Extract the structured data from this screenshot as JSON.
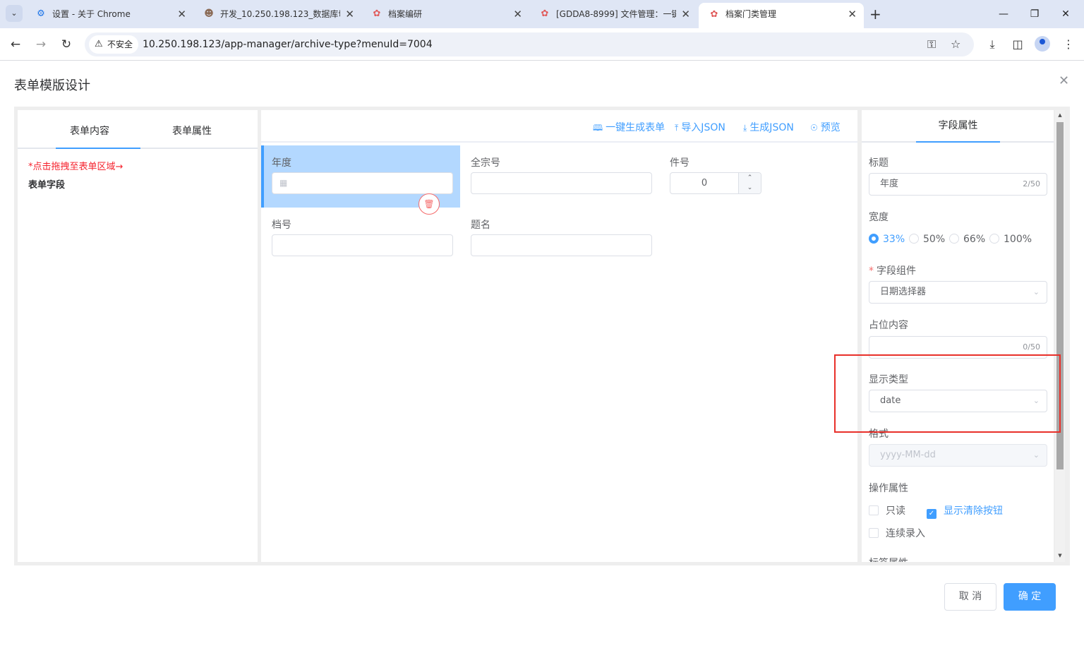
{
  "browser": {
    "tabs": [
      {
        "title": "设置 - 关于 Chrome",
        "icon": "gear-icon"
      },
      {
        "title": "开发_10.250.198.123_数据库切",
        "icon": "avatar-icon"
      },
      {
        "title": "档案编研",
        "icon": "app-logo-icon"
      },
      {
        "title": "[GDDA8-8999] 文件管理：一键",
        "icon": "app-logo-icon"
      },
      {
        "title": "档案门类管理",
        "icon": "app-logo-icon",
        "active": true
      }
    ],
    "security_label": "不安全",
    "url": "10.250.198.123/app-manager/archive-type?menuId=7004"
  },
  "dialog": {
    "title": "表单模版设计",
    "left_tabs": [
      "表单内容",
      "表单属性"
    ],
    "hint": "*点击拖拽至表单区域→",
    "fields_title": "表单字段",
    "actions": [
      {
        "label": "一键生成表单",
        "icon": "book-icon"
      },
      {
        "label": "导入JSON",
        "icon": "upload-icon"
      },
      {
        "label": "生成JSON",
        "icon": "download-icon"
      },
      {
        "label": "预览",
        "icon": "eye-icon"
      }
    ],
    "form_fields": {
      "year": {
        "label": "年度"
      },
      "fonds": {
        "label": "全宗号"
      },
      "piece": {
        "label": "件号",
        "value": "0"
      },
      "file_no": {
        "label": "档号"
      },
      "subject": {
        "label": "题名"
      }
    },
    "props": {
      "tab": "字段属性",
      "title_label": "标题",
      "title_value": "年度",
      "title_count": "2/50",
      "width_label": "宽度",
      "width_options": [
        "33%",
        "50%",
        "66%",
        "100%"
      ],
      "width_selected": "33%",
      "component_label": "字段组件",
      "component_value": "日期选择器",
      "placeholder_label": "占位内容",
      "placeholder_count": "0/50",
      "display_type_label": "显示类型",
      "display_type_value": "date",
      "format_label": "格式",
      "format_value": "yyyy-MM-dd",
      "operation_label": "操作属性",
      "readonly_label": "只读",
      "readonly_checked": false,
      "clearable_label": "显示清除按钮",
      "clearable_checked": true,
      "continuous_label": "连续录入",
      "continuous_checked": false,
      "next_section_label": "标签属性"
    },
    "cancel_label": "取 消",
    "ok_label": "确 定"
  },
  "colors": {
    "primary": "#409eff",
    "danger": "#f56c6c",
    "highlight_box": "#e8302a",
    "selected_bg": "#b3d8ff"
  }
}
